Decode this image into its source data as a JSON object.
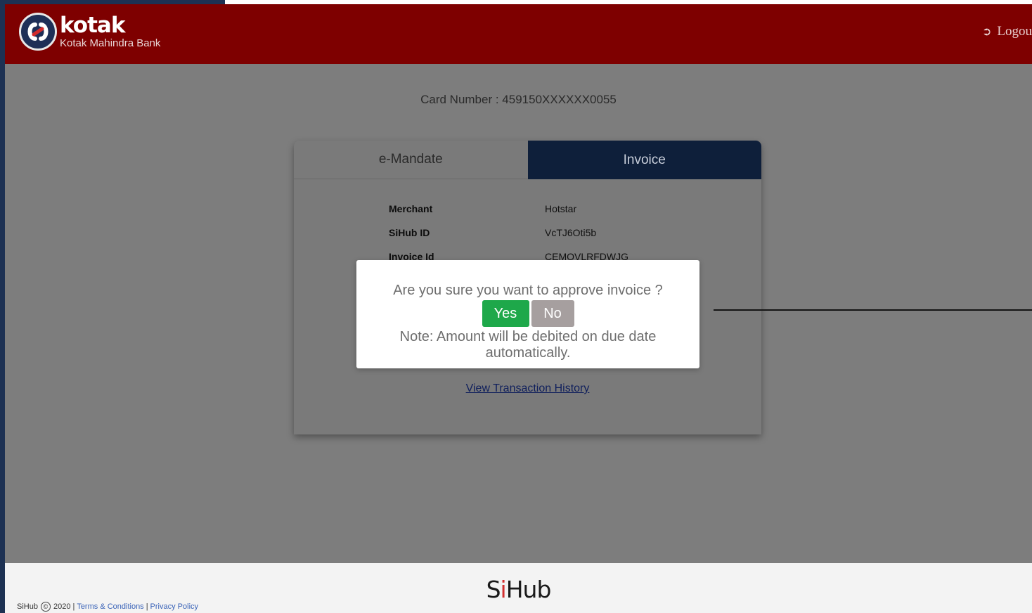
{
  "header": {
    "brand": "kotak",
    "brand_sub": "Kotak Mahindra Bank",
    "logout_label": "Logou",
    "logout_icon": "sign-out-icon"
  },
  "card_number": "Card Number : 459150XXXXXX0055",
  "tabs": [
    {
      "label": "e-Mandate",
      "active": false
    },
    {
      "label": "Invoice",
      "active": true
    }
  ],
  "details": [
    {
      "label": "Merchant",
      "value": "Hotstar"
    },
    {
      "label": "SiHub ID",
      "value": "VcTJ6Oti5b"
    },
    {
      "label": "Invoice Id",
      "value": "CEMOVLRFDWJG"
    }
  ],
  "view_history_label": "View Transaction History",
  "modal": {
    "question": "Are you sure you want to approve invoice ?",
    "yes_label": "Yes",
    "no_label": "No",
    "note": "Note: Amount will be debited on due date automatically."
  },
  "footer": {
    "brand_prefix": "S",
    "brand_accent": "i",
    "brand_suffix": "Hub",
    "legal_name": "SiHub",
    "legal_year": "2020",
    "terms_label": "Terms & Conditions",
    "privacy_label": "Privacy Policy",
    "separator": "|",
    "copyright_symbol": "©"
  },
  "colors": {
    "header_red": "#7e0000",
    "active_tab": "#0e1f3a",
    "yes_green": "#1ea84a",
    "no_gray": "#a69f9f"
  }
}
